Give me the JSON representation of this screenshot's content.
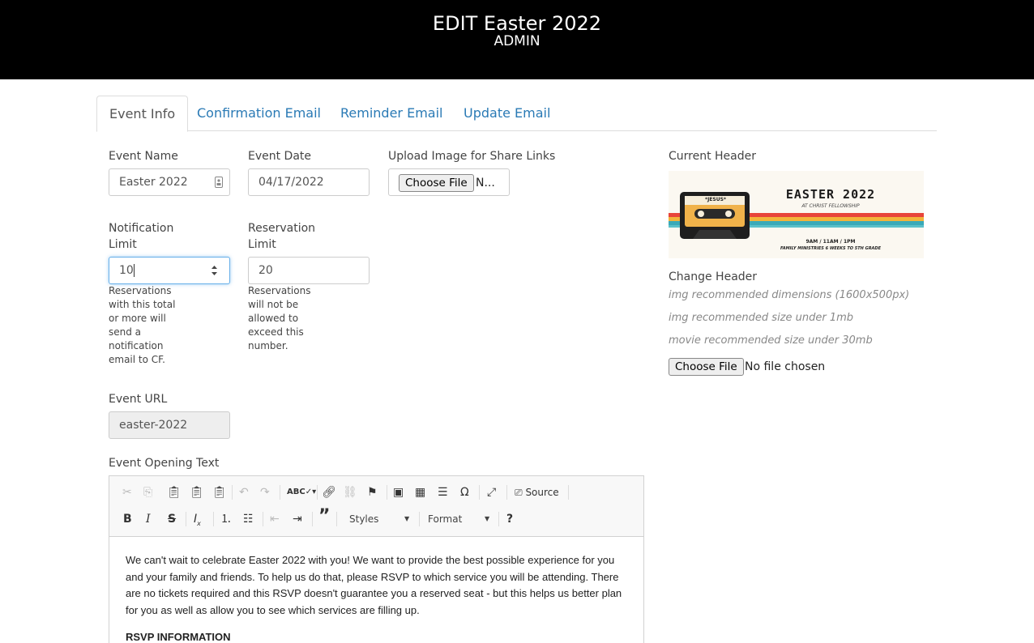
{
  "header": {
    "title": "EDIT Easter 2022",
    "subtitle": "ADMIN"
  },
  "tabs": [
    {
      "label": "Event Info",
      "active": true
    },
    {
      "label": "Confirmation Email"
    },
    {
      "label": "Reminder Email"
    },
    {
      "label": "Update Email"
    }
  ],
  "form": {
    "event_name": {
      "label": "Event Name",
      "value": "Easter 2022"
    },
    "event_date": {
      "label": "Event Date",
      "value": "04/17/2022"
    },
    "upload_share": {
      "label": "Upload Image for Share Links",
      "button": "Choose File",
      "status": "N..."
    },
    "notification_limit": {
      "label_line1": "Notification",
      "label_line2": "Limit",
      "value": "10",
      "help": [
        "Reservations",
        "with this total",
        "or more will",
        "send a",
        "notification",
        "email to CF."
      ]
    },
    "reservation_limit": {
      "label_line1": "Reservation",
      "label_line2": "Limit",
      "value": "20",
      "help": [
        "Reservations",
        "will not be",
        "allowed to",
        "exceed this",
        "number."
      ]
    },
    "event_url": {
      "label": "Event URL",
      "value": "easter-2022"
    },
    "opening_text": {
      "label": "Event Opening Text"
    }
  },
  "current_header": {
    "label": "Current Header",
    "image": {
      "title": "EASTER 2022",
      "subtitle": "AT CHRIST FELLOWSHIP",
      "times": "9AM  /  11AM  /  1PM",
      "note": "FAMILY MINISTRIES 6 WEEKS TO 5TH GRADE",
      "tape_label": "*JESUS*"
    }
  },
  "change_header": {
    "label": "Change Header",
    "hints": [
      "img recommended dimensions (1600x500px)",
      "img recommended size under 1mb",
      "movie recommended size under 30mb"
    ],
    "button": "Choose File",
    "status": "No file chosen"
  },
  "editor": {
    "toolbar": {
      "source_label": "Source",
      "styles_label": "Styles",
      "format_label": "Format"
    },
    "paragraph": "We can't wait to celebrate Easter 2022 with you! We want to provide the best possible experience for you and your family and friends. To help us do that, please RSVP to which service you will be attending. There are no tickets required and this RSVP doesn't guarantee you a reserved seat - but this helps us better plan for you as well as allow you to see which services are filling up.",
    "heading": "RSVP INFORMATION"
  },
  "colors": {
    "tab_link": "#2a7ab5",
    "header_bg": "#000000",
    "focus": "#66afe9"
  }
}
